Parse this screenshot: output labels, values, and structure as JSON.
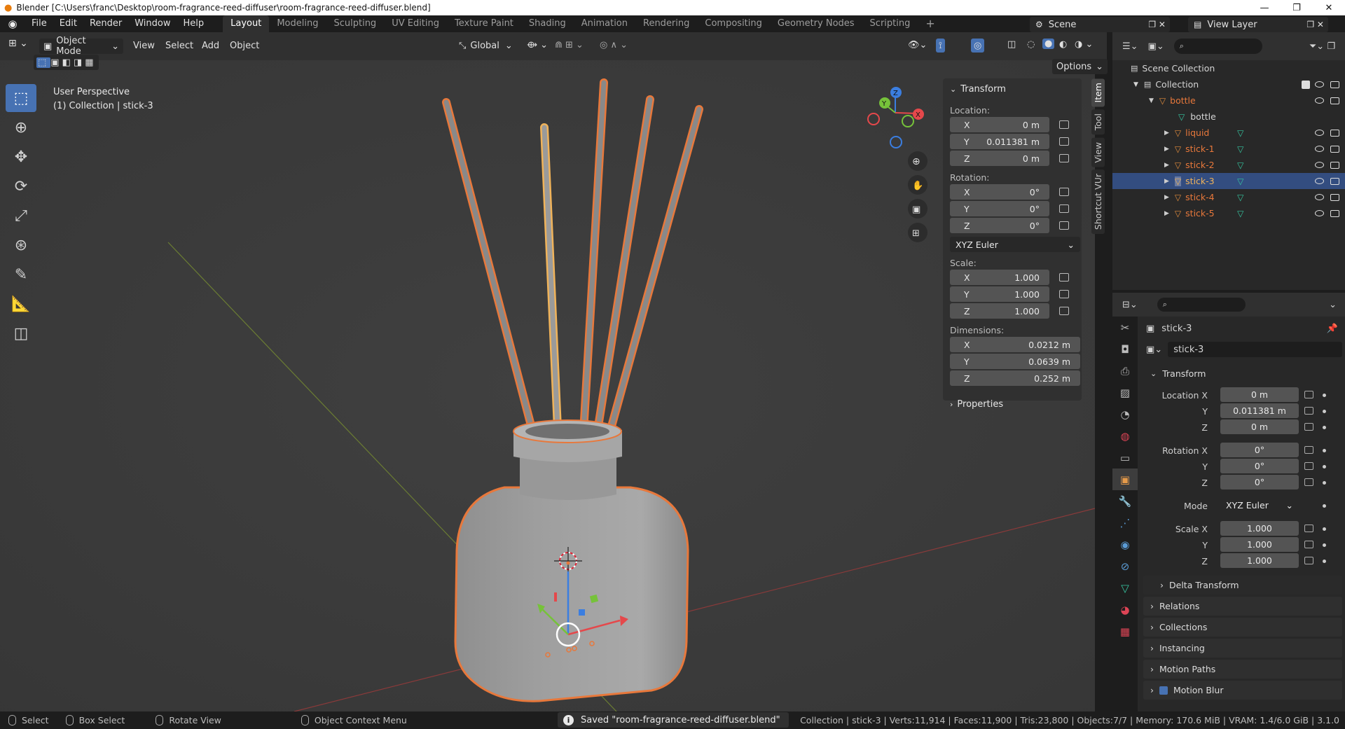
{
  "window": {
    "title": "Blender [C:\\Users\\franc\\Desktop\\room-fragrance-reed-diffuser\\room-fragrance-reed-diffuser.blend]"
  },
  "menu": [
    "File",
    "Edit",
    "Render",
    "Window",
    "Help"
  ],
  "workspaces": [
    "Layout",
    "Modeling",
    "Sculpting",
    "UV Editing",
    "Texture Paint",
    "Shading",
    "Animation",
    "Rendering",
    "Compositing",
    "Geometry Nodes",
    "Scripting"
  ],
  "active_workspace": "Layout",
  "scene": {
    "name": "Scene",
    "view_layer": "View Layer"
  },
  "viewport_header": {
    "mode": "Object Mode",
    "menus": [
      "View",
      "Select",
      "Add",
      "Object"
    ],
    "orientation": "Global",
    "options": "Options"
  },
  "viewport": {
    "perspective": "User Perspective",
    "context": "(1) Collection | stick-3"
  },
  "gizmo_axes": {
    "x": "X",
    "y": "Y",
    "z": "Z"
  },
  "colors": {
    "accent": "#4772b3",
    "selected_object": "#e8783b",
    "mesh_data": "#36c5a0",
    "outliner_selection": "#334d80"
  },
  "npanel": {
    "section": "Transform",
    "location_label": "Location:",
    "location": [
      {
        "axis": "X",
        "value": "0 m"
      },
      {
        "axis": "Y",
        "value": "0.011381 m"
      },
      {
        "axis": "Z",
        "value": "0 m"
      }
    ],
    "rotation_label": "Rotation:",
    "rotation": [
      {
        "axis": "X",
        "value": "0°"
      },
      {
        "axis": "Y",
        "value": "0°"
      },
      {
        "axis": "Z",
        "value": "0°"
      }
    ],
    "rotation_mode": "XYZ Euler",
    "scale_label": "Scale:",
    "scale": [
      {
        "axis": "X",
        "value": "1.000"
      },
      {
        "axis": "Y",
        "value": "1.000"
      },
      {
        "axis": "Z",
        "value": "1.000"
      }
    ],
    "dimensions_label": "Dimensions:",
    "dimensions": [
      {
        "axis": "X",
        "value": "0.0212 m"
      },
      {
        "axis": "Y",
        "value": "0.0639 m"
      },
      {
        "axis": "Z",
        "value": "0.252 m"
      }
    ],
    "properties_section": "Properties",
    "tabs": [
      "Item",
      "Tool",
      "View",
      "Shortcut VUr"
    ]
  },
  "outliner": {
    "scene_collection": "Scene Collection",
    "collection": "Collection",
    "parent": "bottle",
    "parent_mesh": "bottle",
    "children": [
      "liquid",
      "stick-1",
      "stick-2",
      "stick-3",
      "stick-4",
      "stick-5"
    ],
    "selected": "stick-3"
  },
  "properties": {
    "object_name": "stick-3",
    "data_name": "stick-3",
    "transform_section": "Transform",
    "location_label": "Location X",
    "location": [
      "0 m",
      "0.011381 m",
      "0 m"
    ],
    "rotation_label": "Rotation X",
    "rotation": [
      "0°",
      "0°",
      "0°"
    ],
    "mode_label": "Mode",
    "mode": "XYZ Euler",
    "scale_label": "Scale X",
    "scale": [
      "1.000",
      "1.000",
      "1.000"
    ],
    "axis_y": "Y",
    "axis_z": "Z",
    "delta_transform": "Delta Transform",
    "sections": [
      "Relations",
      "Collections",
      "Instancing",
      "Motion Paths",
      "Motion Blur"
    ]
  },
  "statusbar": {
    "select": "Select",
    "box_select": "Box Select",
    "rotate_view": "Rotate View",
    "context_menu": "Object Context Menu",
    "saved": "Saved \"room-fragrance-reed-diffuser.blend\"",
    "stats": "Collection | stick-3 | Verts:11,914 | Faces:11,900 | Tris:23,800 | Objects:7/7 | Memory: 170.6 MiB | VRAM: 1.4/6.0 GiB | 3.1.0"
  }
}
